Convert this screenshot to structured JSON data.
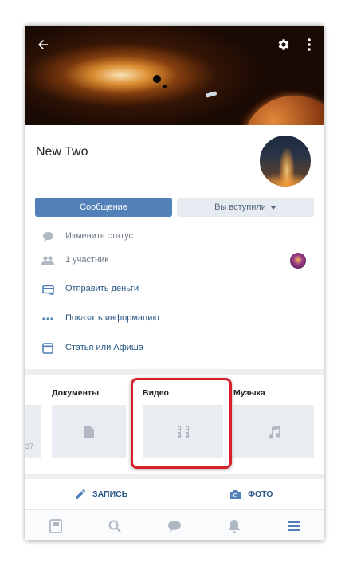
{
  "header": {
    "title": "New Two",
    "icons": [
      "back-arrow-icon",
      "gear-icon",
      "more-vertical-icon"
    ]
  },
  "buttons": {
    "message": "Сообщение",
    "joined": "Вы вступили"
  },
  "info_rows": [
    {
      "label": "Изменить статус",
      "icon": "comment-icon",
      "style": "gray"
    },
    {
      "label": "1 участник",
      "icon": "people-icon",
      "style": "gray"
    },
    {
      "label": "Отправить деньги",
      "icon": "card-icon",
      "style": "blue"
    },
    {
      "label": "Показать информацию",
      "icon": "dots-horizontal-icon",
      "style": "blue"
    },
    {
      "label": "Статья или Афиша",
      "icon": "article-icon",
      "style": "blue"
    }
  ],
  "media": {
    "tabs": [
      "Документы",
      "Видео",
      "Музыка"
    ],
    "partial_text": "37"
  },
  "actions": {
    "post": "ЗАПИСЬ",
    "photo": "ФОТО"
  },
  "bottom_nav": [
    "news-icon",
    "search-icon",
    "messages-icon",
    "notifications-icon",
    "menu-icon"
  ],
  "colors": {
    "accent": "#5181b8",
    "link": "#2a5885",
    "highlight": "#d8202a"
  }
}
